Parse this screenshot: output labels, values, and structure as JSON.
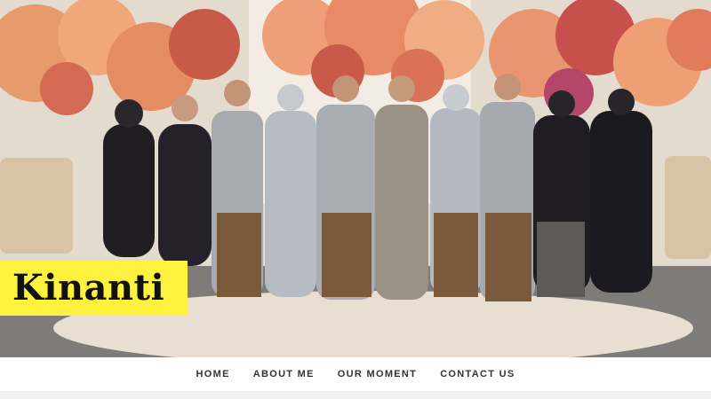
{
  "site": {
    "title": "Kinanti"
  },
  "hero": {
    "image": "wedding-family-group-photo"
  },
  "nav": {
    "items": [
      {
        "label": "HOME"
      },
      {
        "label": "ABOUT ME"
      },
      {
        "label": "OUR MOMENT"
      },
      {
        "label": "CONTACT US"
      }
    ]
  },
  "colors": {
    "title_background": "#fff23f",
    "nav_text": "#333333",
    "page_background": "#ffffff"
  }
}
